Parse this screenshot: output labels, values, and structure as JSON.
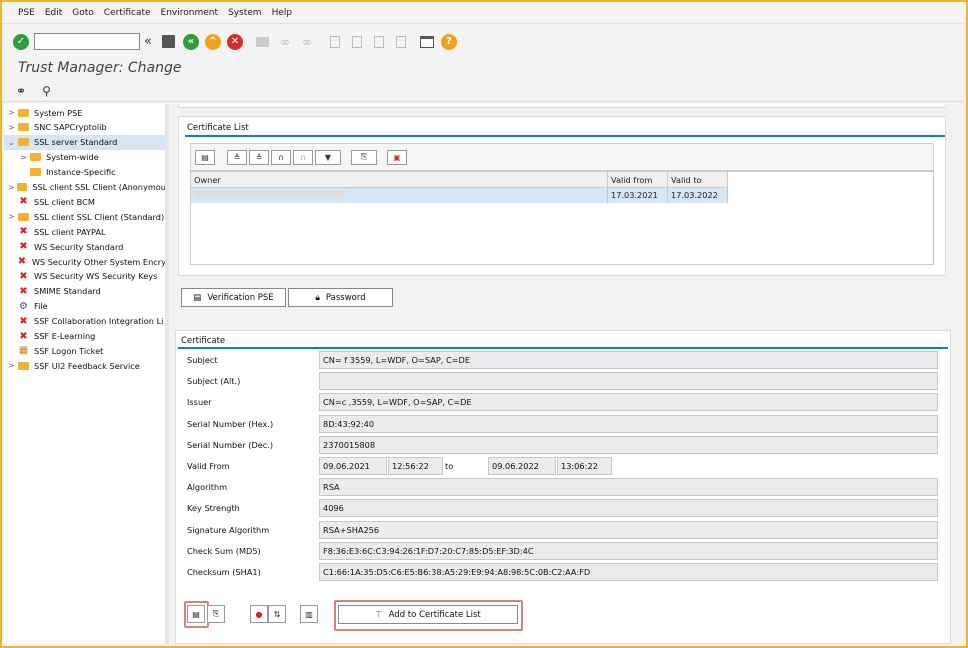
{
  "menu": [
    "PSE",
    "Edit",
    "Goto",
    "Certificate",
    "Environment",
    "System",
    "Help"
  ],
  "toolbar": {
    "command_field": "",
    "collapse": "«"
  },
  "title": "Trust Manager: Change",
  "tree": [
    {
      "label": "System PSE",
      "icon": "folder",
      "arrow": ">",
      "indent": 0
    },
    {
      "label": "SNC SAPCryptolib",
      "icon": "folder",
      "arrow": ">",
      "indent": 0
    },
    {
      "label": "SSL server Standard",
      "icon": "folder",
      "arrow": "v",
      "indent": 0,
      "selected": true
    },
    {
      "label": "System-wide",
      "icon": "folder",
      "arrow": ">",
      "indent": 1
    },
    {
      "label": "Instance-Specific",
      "icon": "folder",
      "arrow": "",
      "indent": 1
    },
    {
      "label": "SSL client SSL Client (Anonymou",
      "icon": "folder",
      "arrow": ">",
      "indent": 0
    },
    {
      "label": "SSL client BCM",
      "icon": "x",
      "arrow": "",
      "indent": 0
    },
    {
      "label": "SSL client SSL Client (Standard)",
      "icon": "folder",
      "arrow": ">",
      "indent": 0
    },
    {
      "label": "SSL client PAYPAL",
      "icon": "x",
      "arrow": "",
      "indent": 0
    },
    {
      "label": "WS Security Standard",
      "icon": "x",
      "arrow": "",
      "indent": 0
    },
    {
      "label": "WS Security Other System Encry",
      "icon": "x",
      "arrow": "",
      "indent": 0
    },
    {
      "label": "WS Security WS Security Keys",
      "icon": "x",
      "arrow": "",
      "indent": 0
    },
    {
      "label": "SMIME Standard",
      "icon": "x",
      "arrow": "",
      "indent": 0
    },
    {
      "label": "File",
      "icon": "file",
      "arrow": "",
      "indent": 0
    },
    {
      "label": "SSF Collaboration Integration Li",
      "icon": "x",
      "arrow": "",
      "indent": 0
    },
    {
      "label": "SSF E-Learning",
      "icon": "x",
      "arrow": "",
      "indent": 0
    },
    {
      "label": "SSF Logon Ticket",
      "icon": "ticket",
      "arrow": "",
      "indent": 0
    },
    {
      "label": "SSF UI2 Feedback Service",
      "icon": "folder",
      "arrow": ">",
      "indent": 0
    }
  ],
  "cert_list": {
    "title": "Certificate List",
    "headers": [
      "Owner",
      "Valid from",
      "Valid to"
    ],
    "row": {
      "owner": "",
      "valid_from": "17.03.2021",
      "valid_to": "17.03.2022"
    }
  },
  "buttons": {
    "verification_pse": "Verification PSE",
    "password": "Password",
    "add_to_list": "Add to Certificate List"
  },
  "certificate": {
    "title": "Certificate",
    "subject_label": "Subject",
    "subject": "CN=        f   3559, L=WDF, O=SAP, C=DE",
    "subject_alt_label": "Subject (Alt.)",
    "subject_alt": "",
    "issuer_label": "Issuer",
    "issuer": "CN=c       ,3559, L=WDF, O=SAP, C=DE",
    "serial_hex_label": "Serial Number (Hex.)",
    "serial_hex": "8D:43:92:40",
    "serial_dec_label": "Serial Number (Dec.)",
    "serial_dec": "2370015808",
    "valid_from_label": "Valid From",
    "valid_from_date": "09.06.2021",
    "valid_from_time": "12:56:22",
    "to": "to",
    "valid_to_date": "09.06.2022",
    "valid_to_time": "13:06:22",
    "algorithm_label": "Algorithm",
    "algorithm": "RSA",
    "key_strength_label": "Key Strength",
    "key_strength": "4096",
    "sig_alg_label": "Signature Algorithm",
    "sig_alg": "RSA+SHA256",
    "md5_label": "Check Sum (MD5)",
    "md5": "F8:36:E3:6C:C3:94:26:1F:D7:20:C7:85:D5:EF:3D:4C",
    "sha1_label": "Checksum (SHA1)",
    "sha1": "C1:66:1A:35:D5:C6:E5:B6:38:A5:29:E9:94:A8:98:5C:0B:C2:AA:FD"
  },
  "colors": {
    "accent": "#1b7fa6",
    "highlight_box": "#d87f7f",
    "selected_row": "#d5e6f5",
    "frame": "#f0b429"
  }
}
